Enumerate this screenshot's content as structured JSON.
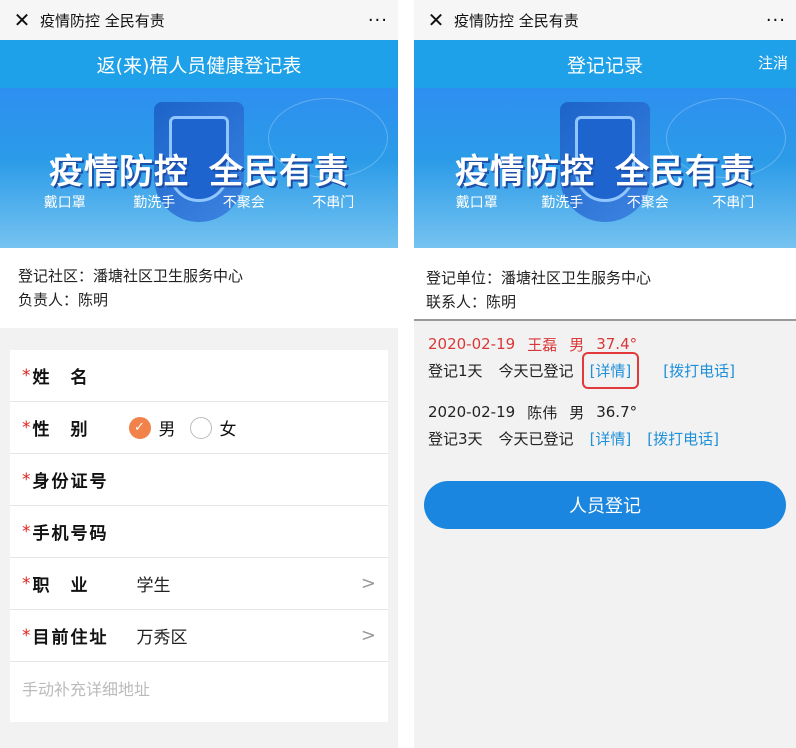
{
  "left": {
    "topbar": {
      "title": "疫情防控 全民有责",
      "close": "✕",
      "more": "···"
    },
    "header": {
      "title": "返(来)梧人员健康登记表"
    },
    "banner": {
      "slogan_a": "疫情防控",
      "slogan_b": "全民有责",
      "tips": [
        "戴口罩",
        "勤洗手",
        "不聚会",
        "不串门"
      ]
    },
    "info": {
      "community_label": "登记社区：",
      "community": "潘塘社区卫生服务中心",
      "contact_label": "负责人：",
      "contact": "陈明"
    },
    "form": {
      "name_label": "姓　名",
      "gender_label": "性　别",
      "gender_male": "男",
      "gender_female": "女",
      "gender_selected": "男",
      "id_label": "身份证号",
      "phone_label": "手机号码",
      "job_label": "职　业",
      "job_value": "学生",
      "address_label": "目前住址",
      "address_value": "万秀区",
      "detail_placeholder": "手动补充详细地址",
      "star": "*",
      "chevron": ">"
    }
  },
  "right": {
    "topbar": {
      "title": "疫情防控 全民有责",
      "close": "✕",
      "more": "···"
    },
    "header": {
      "title": "登记记录",
      "logout": "注消"
    },
    "banner": {
      "slogan_a": "疫情防控",
      "slogan_b": "全民有责",
      "tips": [
        "戴口罩",
        "勤洗手",
        "不聚会",
        "不串门"
      ]
    },
    "info": {
      "unit_label": "登记单位：",
      "unit": "潘塘社区卫生服务中心",
      "contact_label": "联系人：",
      "contact": "陈明"
    },
    "records": [
      {
        "date": "2020-02-19",
        "name": "王磊",
        "gender": "男",
        "temp": "37.4°",
        "days": "登记1天",
        "today": "今天已登记",
        "detail": "[详情]",
        "call": "[拨打电话]"
      },
      {
        "date": "2020-02-19",
        "name": "陈伟",
        "gender": "男",
        "temp": "36.7°",
        "days": "登记3天",
        "today": "今天已登记",
        "detail": "[详情]",
        "call": "[拨打电话]"
      }
    ],
    "register_button": "人员登记"
  },
  "colors": {
    "header_blue": "#1ea1e8",
    "button_blue": "#1a86df",
    "alert_red": "#d93838",
    "link_blue": "#1e90d8",
    "radio_orange": "#f0824a"
  }
}
